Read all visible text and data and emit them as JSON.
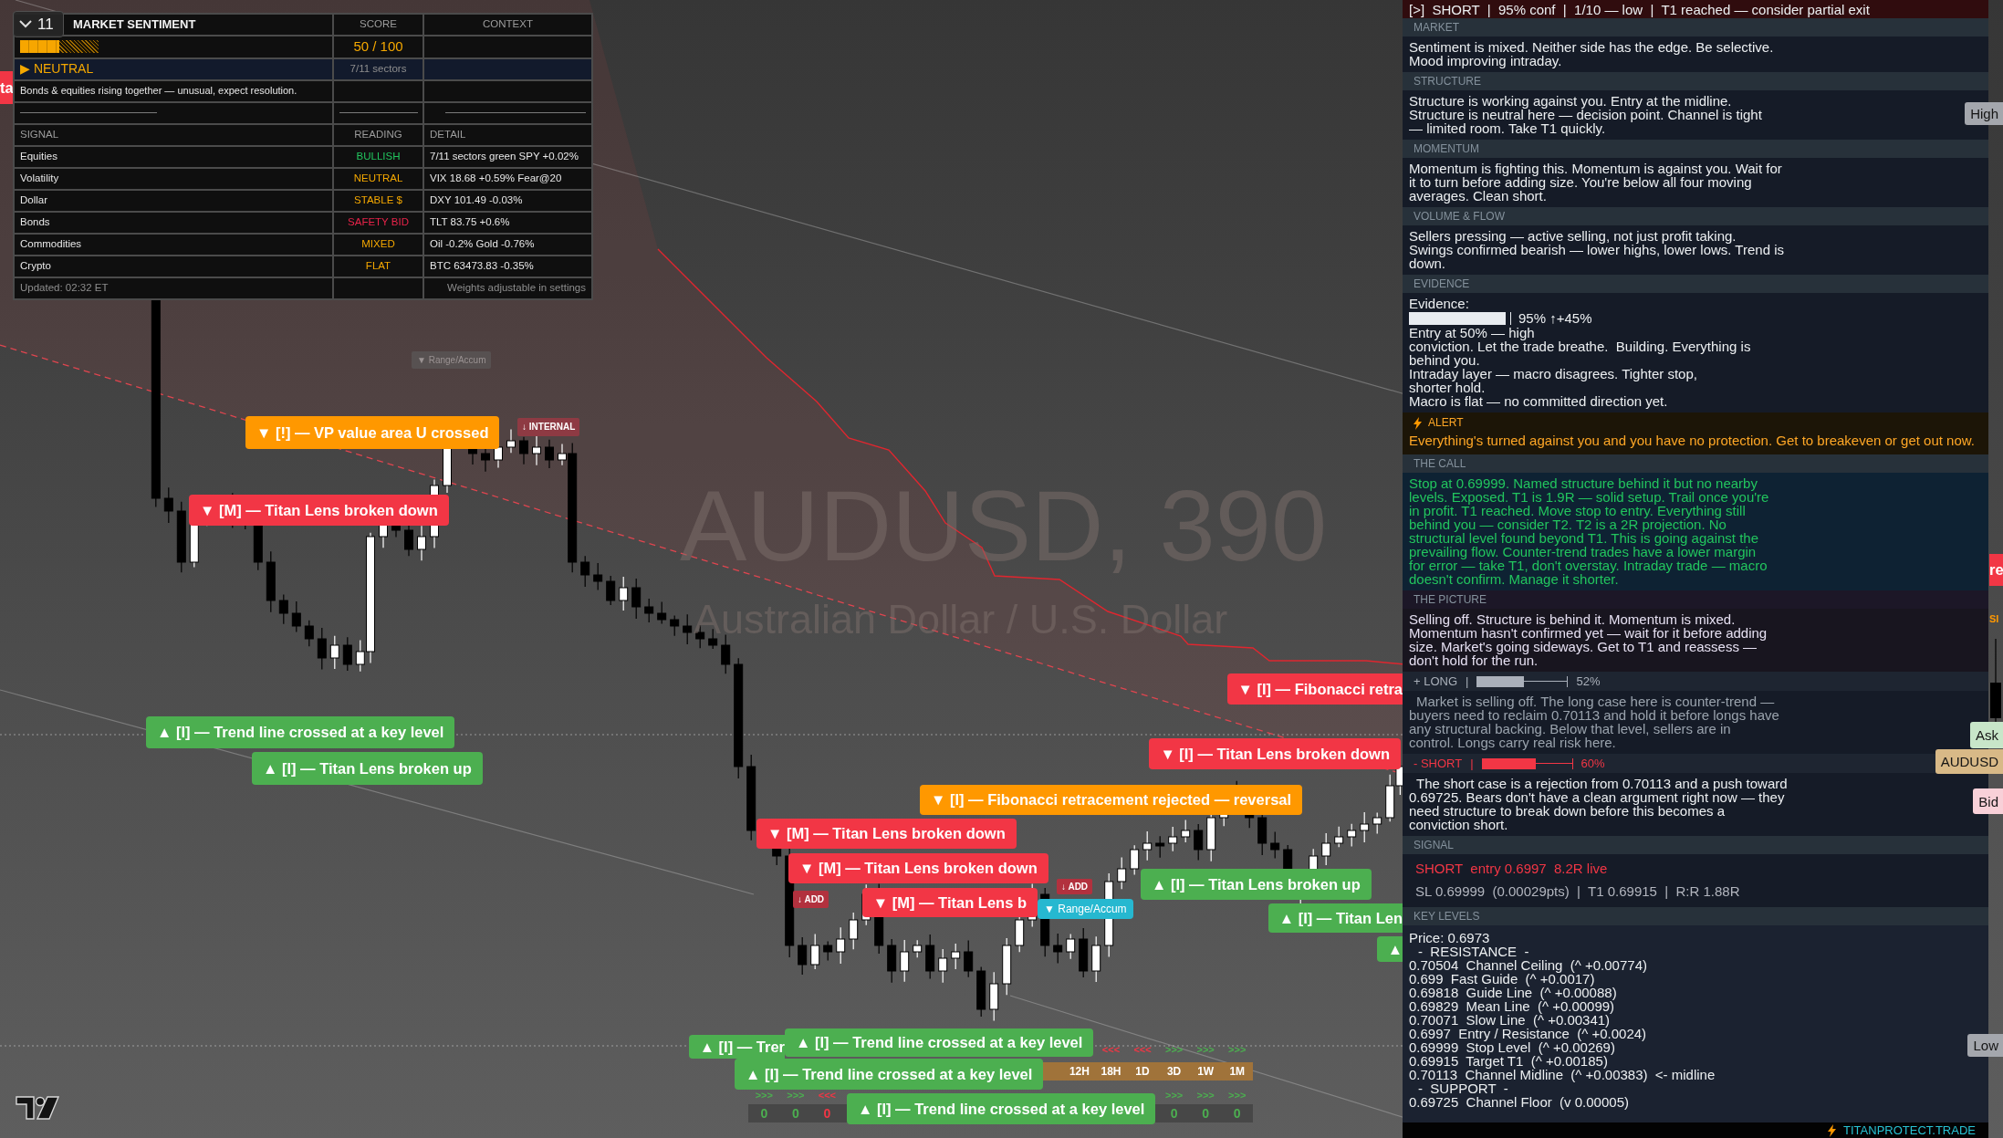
{
  "sentiment": {
    "title": "MARKET SENTIMENT",
    "score_header": "SCORE",
    "context_header": "CONTEXT",
    "score": {
      "level": 0.5,
      "text": "50 / 100"
    },
    "mood": {
      "label": "▶ NEUTRAL",
      "sectors": "7/11 sectors"
    },
    "note": "Bonds & equities rising together — unusual, expect resolution.",
    "columns": [
      "SIGNAL",
      "READING",
      "DETAIL"
    ],
    "signals": [
      {
        "name": "Equities",
        "reading": "BULLISH",
        "color": "#22c55e",
        "detail": "7/11 sectors green  SPY +0.02%"
      },
      {
        "name": "Volatility",
        "reading": "NEUTRAL",
        "color": "#f5a800",
        "detail": "VIX 18.68  +0.59%  Fear@20"
      },
      {
        "name": "Dollar",
        "reading": "STABLE $",
        "color": "#f5a800",
        "detail": "DXY 101.49  -0.03%"
      },
      {
        "name": "Bonds",
        "reading": "SAFETY BID",
        "color": "#e8234a",
        "detail": "TLT 83.75  +0.6%"
      },
      {
        "name": "Commodities",
        "reading": "MIXED",
        "color": "#f5a800",
        "detail": "Oil -0.2%  Gold -0.76%"
      },
      {
        "name": "Crypto",
        "reading": "FLAT",
        "color": "#f5a800",
        "detail": "BTC 63473.83  -0.35%"
      }
    ],
    "updated": "Updated: 02:32 ET",
    "footnote": "Weights adjustable in settings"
  },
  "chart": {
    "toggle": {
      "label": "11"
    },
    "symbol": "AUDUSD, 390",
    "description": "Australian Dollar / U.S. Dollar",
    "labels": [
      {
        "kind": "label",
        "text": "ta",
        "color": "#f23645"
      },
      {
        "kind": "ghost",
        "text": "▼ Range/Accum",
        "color": "#575151"
      },
      {
        "kind": "label",
        "text": "▼ [!] — VP value area U crossed",
        "color": "#ff9800"
      },
      {
        "kind": "tag",
        "text": "↓ INTERNAL",
        "color": "#8e3a43"
      },
      {
        "kind": "label",
        "text": "▼ [M] — Titan Lens broken down",
        "color": "#f23645"
      },
      {
        "kind": "label",
        "text": "▲ [I] — Trend line crossed at a key level",
        "color": "#4caf50"
      },
      {
        "kind": "label",
        "text": "▲ [I] — Titan Lens broken up",
        "color": "#4caf50"
      },
      {
        "kind": "label",
        "text": "▼ [I] — Fibonacci retra",
        "color": "#f23645"
      },
      {
        "kind": "label",
        "text": "▼ [I] — Titan Lens broken down",
        "color": "#f23645"
      },
      {
        "kind": "label",
        "text": "▼ [I] — Fibonacci retracement rejected — reversal",
        "color": "#ff9800"
      },
      {
        "kind": "label",
        "text": "▼ [M] — Titan Lens broken down",
        "color": "#f23645"
      },
      {
        "kind": "label",
        "text": "▼ [M] — Titan Lens broken down",
        "color": "#f23645"
      },
      {
        "kind": "tag",
        "text": "↓ ADD",
        "color": "#b2313e"
      },
      {
        "kind": "label",
        "text": "▲ [I] — Titan Lens broken up",
        "color": "#4caf50"
      },
      {
        "kind": "tag",
        "text": "↓ ADD",
        "color": "#b2313e"
      },
      {
        "kind": "label",
        "text": "▼ [M] — Titan Lens b",
        "color": "#f23645"
      },
      {
        "kind": "label",
        "text": "▼ Range/Accum",
        "color": "#26b8d0"
      },
      {
        "kind": "label",
        "text": "▲ [I] — Titan Len",
        "color": "#4caf50"
      },
      {
        "kind": "label",
        "text": "▲",
        "color": "#4caf50"
      },
      {
        "kind": "label",
        "text": "▲ [I] — Trer",
        "color": "#4caf50"
      },
      {
        "kind": "label",
        "text": "▲ [I] — Trend line crossed at a key level",
        "color": "#4caf50"
      },
      {
        "kind": "label",
        "text": "▲ [I] — Trend line crossed at a key level",
        "color": "#4caf50"
      },
      {
        "kind": "label",
        "text": "▲ [I] — Trend line crossed at a key level",
        "color": "#4caf50"
      },
      {
        "kind": "label",
        "text": "re",
        "color": "#f23645"
      },
      {
        "kind": "text",
        "text": "SI",
        "color": "#ff9800"
      }
    ],
    "timeframe_table": {
      "left_columns": [
        {
          "bottom": ">>>",
          "count": "0",
          "color": "#4caf50"
        },
        {
          "bottom": ">>>",
          "count": "0",
          "color": "#4caf50"
        },
        {
          "bottom": "<<<",
          "count": "0",
          "color": "#f23645"
        }
      ],
      "right_columns": [
        {
          "label": "12H"
        },
        {
          "label": "18H",
          "top": "<<<",
          "color": "#f23645"
        },
        {
          "label": "1D",
          "top": "<<<",
          "color": "#f23645"
        },
        {
          "label": "3D",
          "top": ">>>",
          "bottom": ">>>",
          "count": "0",
          "color": "#4caf50"
        },
        {
          "label": "1W",
          "top": ">>>",
          "bottom": ">>>",
          "count": "0",
          "color": "#4caf50"
        },
        {
          "label": "1M",
          "top": ">>>",
          "bottom": ">>>",
          "count": "0",
          "color": "#4caf50"
        }
      ]
    },
    "price_tags": [
      {
        "text": "High",
        "color": "#a4a7ad"
      },
      {
        "text": "Ask",
        "color": "#c8e6c9"
      },
      {
        "text": "AUDUSD",
        "color": "#d8b987"
      },
      {
        "text": "Bid",
        "color": "#f8d0d8"
      },
      {
        "text": "Low",
        "color": "#a4a7ad"
      }
    ]
  },
  "panel": {
    "header": "[>]  SHORT  |  95% conf  |  1/10 — low  |  T1 reached — consider partial exit",
    "sections": [
      {
        "kind": "text",
        "title": "MARKET",
        "body": "Sentiment is mixed. Neither side has the edge. Be selective.\nMood improving intraday."
      },
      {
        "kind": "text",
        "title": "STRUCTURE",
        "body": "Structure is working against you. Entry at the midline.\nStructure is neutral here — decision point. Channel is tight\n— limited room. Take T1 quickly."
      },
      {
        "kind": "text",
        "title": "MOMENTUM",
        "body": "Momentum is fighting this. Momentum is against you. Wait for\nit to turn before adding size. You're below all four moving\naverages. Clean short."
      },
      {
        "kind": "text",
        "title": "VOLUME & FLOW",
        "body": "Sellers pressing — active selling, not just profit taking.\nSwings confirmed bearish — lower highs, lower lows. Trend is\ndown."
      },
      {
        "kind": "evidence",
        "title": "EVIDENCE",
        "intro": "Evidence:",
        "level": 0.95,
        "reading": "95% ↑+45%",
        "body": "Entry at 50% — high\nconviction. Let the trade breathe.  Building. Everything is\nbehind you.\nIntraday layer — macro disagrees. Tighter stop,\nshorter hold.\nMacro is flat — no committed direction yet."
      },
      {
        "kind": "alert",
        "title": "ALERT",
        "body": "Everything's turned against you and you have no protection. Get to breakeven or get out now."
      },
      {
        "kind": "call",
        "title": "THE CALL",
        "body": "Stop at 0.69999. Named structure behind it but no nearby\nlevels. Exposed. T1 is 1.9R — solid setup. Trail once you're\nin profit. T1 reached. Move stop to entry. Everything still\nbehind you — consider T2. T2 is a 2R projection. No\nstructural level found beyond T1. This is going against the\nprevailing flow. Counter-trend trades have a lower margin\nfor error — take T1, don't overstay. Intraday trade — macro\ndoesn't confirm. Manage it shorter."
      },
      {
        "kind": "picture",
        "title": "THE PICTURE",
        "body": "Selling off. Structure is behind it. Momentum is mixed.\nMomentum hasn't confirmed yet — wait for it before adding\nsize. Market's going sideways. Get to T1 and reassess —\ndon't hold for the run."
      },
      {
        "kind": "case",
        "side": "+ LONG",
        "separator": "|",
        "level": 0.52,
        "reading": "52%",
        "color": "#aab0ba",
        "favored": false,
        "body": "Market is selling off. The long case here is counter-trend —\nbuyers need to reclaim 0.70113 and hold it before longs have\nany structural backing. Below that level, sellers are in\ncontrol. Longs carry real risk here."
      },
      {
        "kind": "case",
        "side": "- SHORT",
        "separator": "|",
        "level": 0.6,
        "reading": "60%",
        "color": "#f23645",
        "favored": true,
        "body": "The short case is a rejection from 0.70113 and a push toward\n0.69725. Bears don't have a clean argument right now — they\nneed structure to break down before this becomes a\nconviction short."
      },
      {
        "kind": "signal",
        "title": "SIGNAL",
        "color": "#f23645",
        "entry": "SHORT  entry 0.6997  8.2R live",
        "risk": "SL 0.69999  (0.00029pts)  |  T1 0.69915  |  R:R 1.88R"
      },
      {
        "kind": "levels",
        "title": "KEY LEVELS",
        "lines": [
          {
            "kind": "line",
            "text": "Price: 0.6973"
          },
          {
            "kind": "heading",
            "text": "-  RESISTANCE  -"
          },
          {
            "kind": "line",
            "text": "0.70504  Channel Ceiling  (^ +0.00774)"
          },
          {
            "kind": "line",
            "text": "0.699  Fast Guide  (^ +0.0017)"
          },
          {
            "kind": "line",
            "text": "0.69818  Guide Line  (^ +0.00088)"
          },
          {
            "kind": "line",
            "text": "0.69829  Mean Line  (^ +0.00099)"
          },
          {
            "kind": "line",
            "text": "0.70071  Slow Line  (^ +0.00341)"
          },
          {
            "kind": "line",
            "text": "0.6997  Entry / Resistance  (^ +0.0024)"
          },
          {
            "kind": "line",
            "text": "0.69999  Stop Level  (^ +0.00269)"
          },
          {
            "kind": "line",
            "text": "0.69915  Target T1  (^ +0.00185)"
          },
          {
            "kind": "line",
            "text": "0.70113  Channel Midline  (^ +0.00383)  <- midline"
          },
          {
            "kind": "heading",
            "text": "-  SUPPORT  -"
          },
          {
            "kind": "line",
            "text": "0.69725  Channel Floor  (v 0.00005)"
          }
        ]
      }
    ],
    "footer": "TITANPROTECT.TRADE"
  }
}
